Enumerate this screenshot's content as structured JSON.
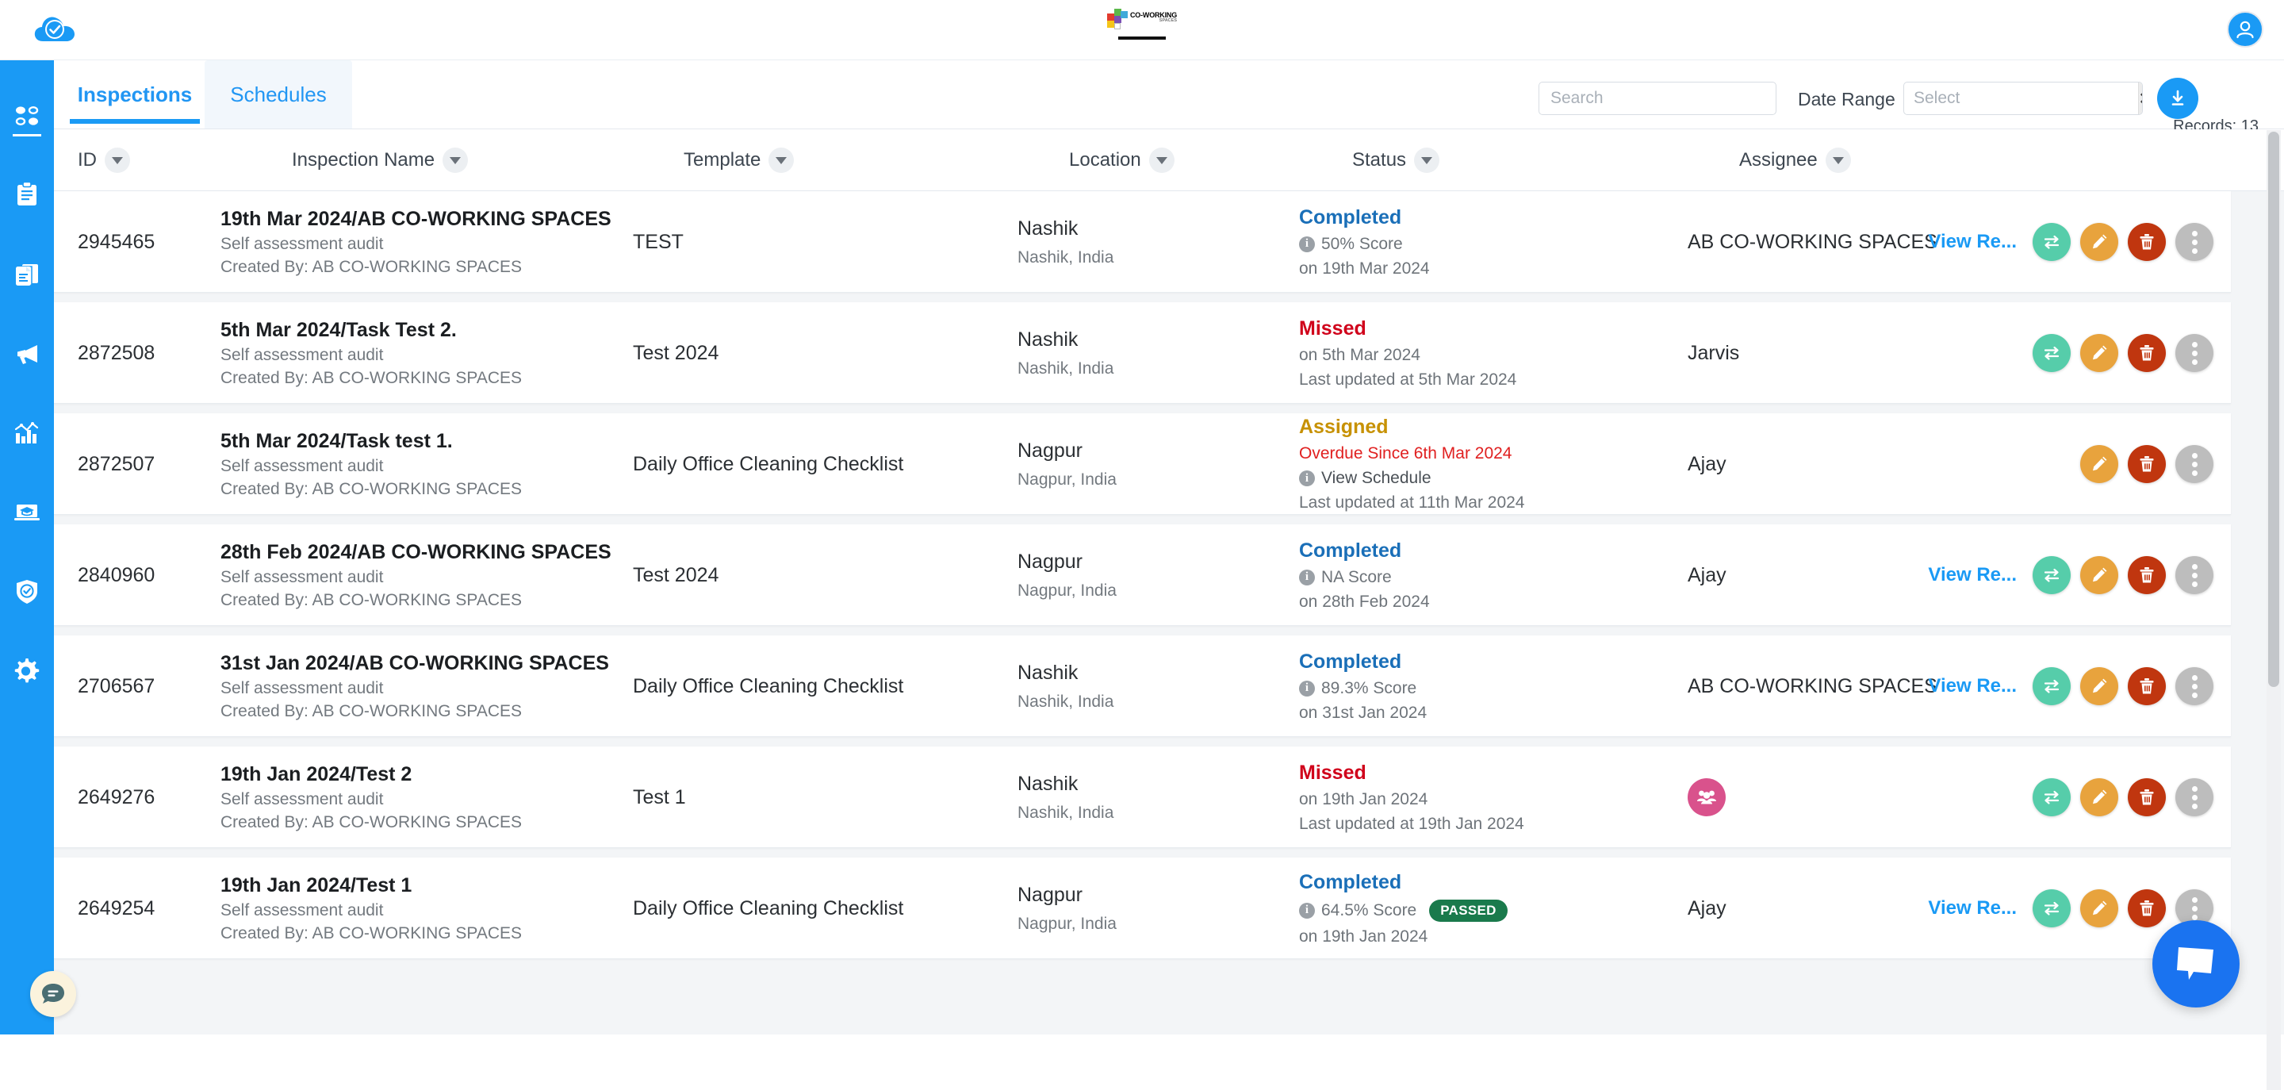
{
  "app": {
    "brand_icon": "cloud-check-icon",
    "center_logo_line1": "CO-WORKING",
    "center_logo_line2": "SPACES",
    "avatar_icon": "user-avatar-icon"
  },
  "sidebar": {
    "items": [
      {
        "icon": "dashboard-grid-icon",
        "name": "dashboard"
      },
      {
        "icon": "clipboard-icon",
        "name": "inspections"
      },
      {
        "icon": "documents-icon",
        "name": "templates"
      },
      {
        "icon": "megaphone-icon",
        "name": "announcements"
      },
      {
        "icon": "bar-chart-icon",
        "name": "analytics"
      },
      {
        "icon": "training-icon",
        "name": "training"
      },
      {
        "icon": "shield-check-icon",
        "name": "compliance"
      },
      {
        "icon": "gear-icon",
        "name": "settings"
      }
    ]
  },
  "tabs": [
    {
      "label": "Inspections",
      "active": true
    },
    {
      "label": "Schedules",
      "active": false
    }
  ],
  "filters": {
    "search_placeholder": "Search",
    "search_value": "",
    "date_range_label": "Date Range",
    "date_select_placeholder": "Select",
    "date_select_value": "",
    "clear_icon": "close-x-icon",
    "download_icon": "download-icon",
    "records_text": "Records: 13"
  },
  "table": {
    "columns": [
      {
        "label": "ID",
        "filter": true
      },
      {
        "label": "Inspection Name",
        "filter": true
      },
      {
        "label": "Template",
        "filter": true
      },
      {
        "label": "Location",
        "filter": true
      },
      {
        "label": "Status",
        "filter": true
      },
      {
        "label": "Assignee",
        "filter": true
      }
    ],
    "rows": [
      {
        "id": "2945465",
        "name": "19th Mar 2024/AB CO-WORKING SPACES",
        "type": "Self assessment audit",
        "created_by": "Created By: AB CO-WORKING SPACES",
        "template": "TEST",
        "location": "Nashik",
        "location_sub": "Nashik, India",
        "status": "Completed",
        "status_kind": "completed",
        "score": "50%  Score",
        "badge": "",
        "date_line": "on 19th Mar 2024",
        "extra_line": "",
        "assignee": "AB CO-WORKING SPACES",
        "assignee_avatar": false,
        "view_link": "View Re...",
        "has_swap": true
      },
      {
        "id": "2872508",
        "name": "5th Mar 2024/Task Test 2.",
        "type": "Self assessment audit",
        "created_by": "Created By: AB CO-WORKING SPACES",
        "template": "Test 2024",
        "location": "Nashik",
        "location_sub": "Nashik, India",
        "status": "Missed",
        "status_kind": "missed",
        "score": "",
        "badge": "",
        "date_line": "on 5th Mar 2024",
        "extra_line": "Last updated at 5th Mar 2024",
        "assignee": "Jarvis",
        "assignee_avatar": false,
        "view_link": "",
        "has_swap": true
      },
      {
        "id": "2872507",
        "name": "5th Mar 2024/Task test 1.",
        "type": "Self assessment audit",
        "created_by": "Created By: AB CO-WORKING SPACES",
        "template": "Daily Office Cleaning Checklist",
        "location": "Nagpur",
        "location_sub": "Nagpur, India",
        "status": "Assigned",
        "status_kind": "assigned",
        "score": "",
        "badge": "",
        "date_line": "Overdue Since 6th Mar 2024",
        "schedule_line": "View Schedule",
        "extra_line": "Last updated at 11th Mar 2024",
        "assignee": "Ajay",
        "assignee_avatar": false,
        "view_link": "",
        "has_swap": false
      },
      {
        "id": "2840960",
        "name": "28th Feb 2024/AB CO-WORKING SPACES",
        "type": "Self assessment audit",
        "created_by": "Created By: AB CO-WORKING SPACES",
        "template": "Test 2024",
        "location": "Nagpur",
        "location_sub": "Nagpur, India",
        "status": "Completed",
        "status_kind": "completed",
        "score": "NA  Score",
        "badge": "",
        "date_line": "on 28th Feb 2024",
        "extra_line": "",
        "assignee": "Ajay",
        "assignee_avatar": false,
        "view_link": "View Re...",
        "has_swap": true
      },
      {
        "id": "2706567",
        "name": "31st Jan 2024/AB CO-WORKING SPACES",
        "type": "Self assessment audit",
        "created_by": "Created By: AB CO-WORKING SPACES",
        "template": "Daily Office Cleaning Checklist",
        "location": "Nashik",
        "location_sub": "Nashik, India",
        "status": "Completed",
        "status_kind": "completed",
        "score": "89.3%  Score",
        "badge": "",
        "date_line": "on 31st Jan 2024",
        "extra_line": "",
        "assignee": "AB CO-WORKING SPACES",
        "assignee_avatar": false,
        "view_link": "View Re...",
        "has_swap": true
      },
      {
        "id": "2649276",
        "name": "19th Jan 2024/Test 2",
        "type": "Self assessment audit",
        "created_by": "Created By: AB CO-WORKING SPACES",
        "template": "Test 1",
        "location": "Nashik",
        "location_sub": "Nashik, India",
        "status": "Missed",
        "status_kind": "missed",
        "score": "",
        "badge": "",
        "date_line": "on 19th Jan 2024",
        "extra_line": "Last updated at 19th Jan 2024",
        "assignee": "",
        "assignee_avatar": true,
        "view_link": "",
        "has_swap": true
      },
      {
        "id": "2649254",
        "name": "19th Jan 2024/Test 1",
        "type": "Self assessment audit",
        "created_by": "Created By: AB CO-WORKING SPACES",
        "template": "Daily Office Cleaning Checklist",
        "location": "Nagpur",
        "location_sub": "Nagpur, India",
        "status": "Completed",
        "status_kind": "completed",
        "score": "64.5% Score",
        "badge": "PASSED",
        "date_line": "on 19th Jan 2024",
        "extra_line": "",
        "assignee": "Ajay",
        "assignee_avatar": false,
        "view_link": "View Re...",
        "has_swap": true
      }
    ]
  },
  "fabs": {
    "left_chat_icon": "chat-bubble-icon",
    "right_chat_icon": "message-bubble-icon"
  },
  "colors": {
    "primary": "#1a9af5",
    "completed": "#1a6fb8",
    "missed": "#d0021b",
    "assigned": "#c79100",
    "overdue": "#e02020",
    "passed_badge": "#1a7a4c",
    "swap_btn": "#56cdaa",
    "edit_btn": "#e8a33d",
    "delete_btn": "#c0360f",
    "more_btn": "#bdbdbd"
  }
}
